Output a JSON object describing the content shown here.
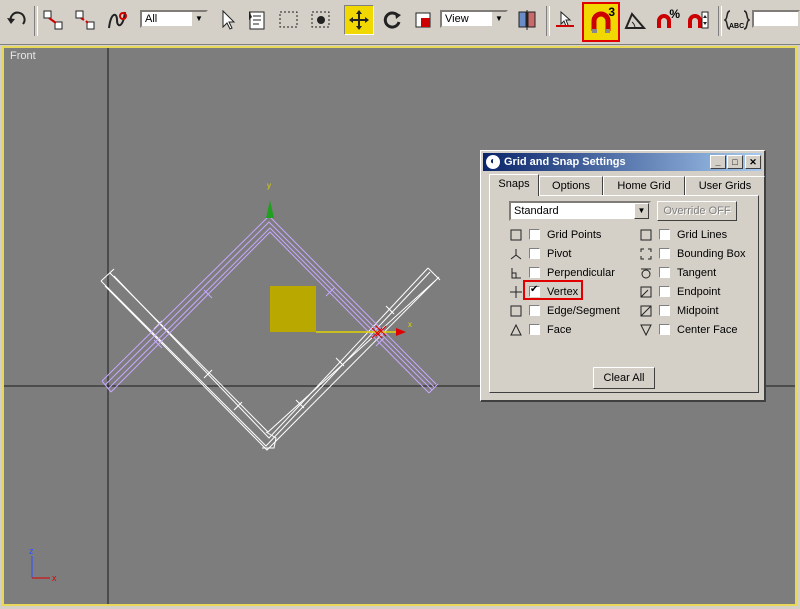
{
  "toolbar": {
    "selection_filter": "All",
    "reference_coord": "View",
    "snap_toggle_label": "3",
    "percent_snap_label": "%",
    "abc_label": "ABC",
    "named_selection_value": ""
  },
  "viewport": {
    "label": "Front",
    "gizmo_y": "y",
    "gizmo_x": "x",
    "axis_z": "z",
    "axis_x": "x"
  },
  "dialog": {
    "title": "Grid and Snap Settings",
    "tabs": [
      "Snaps",
      "Options",
      "Home Grid",
      "User Grids"
    ],
    "active_tab": "Snaps",
    "dropdown_value": "Standard",
    "override_label": "Override OFF",
    "left_options": [
      {
        "label": "Grid Points",
        "checked": false
      },
      {
        "label": "Pivot",
        "checked": false
      },
      {
        "label": "Perpendicular",
        "checked": false
      },
      {
        "label": "Vertex",
        "checked": true
      },
      {
        "label": "Edge/Segment",
        "checked": false
      },
      {
        "label": "Face",
        "checked": false
      }
    ],
    "right_options": [
      {
        "label": "Grid Lines",
        "checked": false
      },
      {
        "label": "Bounding Box",
        "checked": false
      },
      {
        "label": "Tangent",
        "checked": false
      },
      {
        "label": "Endpoint",
        "checked": false
      },
      {
        "label": "Midpoint",
        "checked": false
      },
      {
        "label": "Center Face",
        "checked": false
      }
    ],
    "clear_all_label": "Clear All"
  },
  "colors": {
    "viewport_bg": "#7d7d7d",
    "selected_wire": "#c8a8ff",
    "wire": "#ffffff",
    "gizmo_box": "#b8a800",
    "highlight": "#e00000"
  }
}
